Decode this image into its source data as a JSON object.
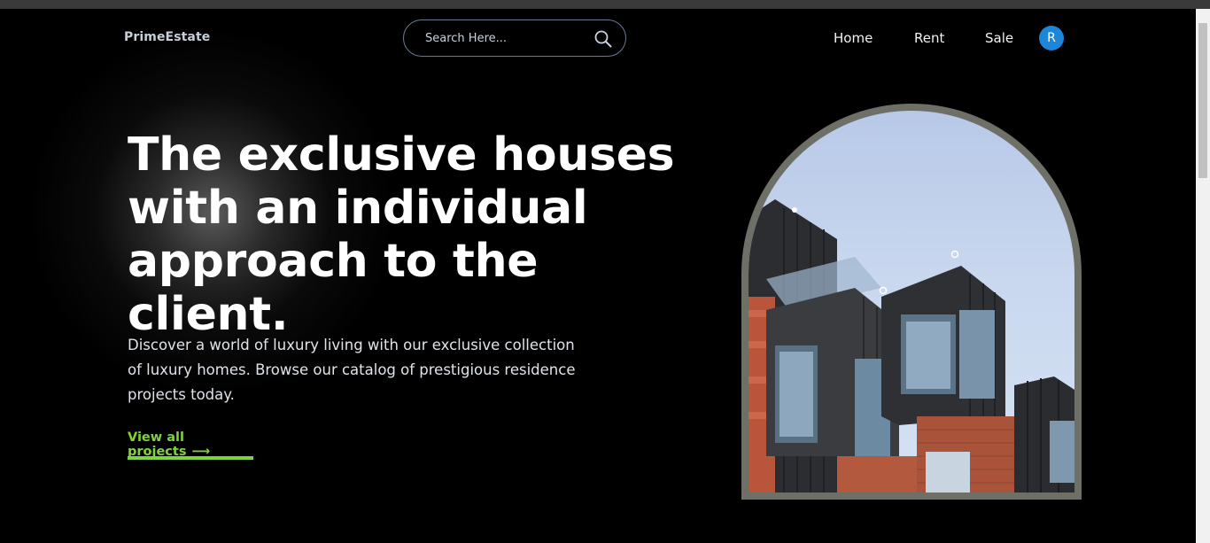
{
  "header": {
    "logo": "PrimeEstate",
    "search_placeholder": "Search Here...",
    "nav": [
      {
        "label": "Home"
      },
      {
        "label": "Rent"
      },
      {
        "label": "Sale"
      }
    ],
    "avatar_initial": "R"
  },
  "hero": {
    "title": "The exclusive houses with an individual approach to the client.",
    "description": "Discover a world of luxury living with our exclusive collection of luxury homes. Browse our catalog of prestigious residence projects today.",
    "cta_label": "View all projects",
    "cta_icon": "arrow-right-icon"
  },
  "colors": {
    "accent_green": "#7fd33c",
    "avatar_blue": "#1c87d8",
    "frame": "#6e6f66"
  }
}
